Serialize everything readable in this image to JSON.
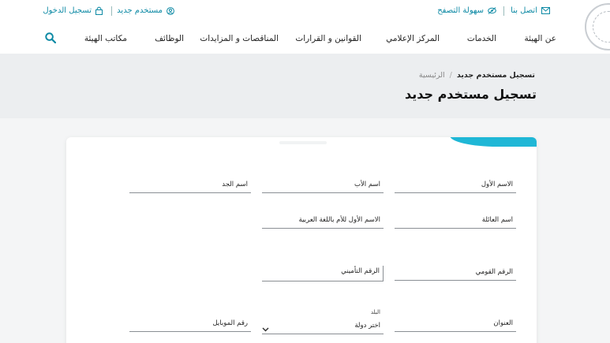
{
  "topbar": {
    "contact": "اتصل بنا",
    "accessibility": "سهولة التصفح",
    "new_user": "مستخدم جديد",
    "login": "تسجيل الدخول"
  },
  "nav": {
    "items": [
      "عن الهيئة",
      "الخدمات",
      "المركز الإعلامي",
      "القوانين و القرارات",
      "المناقصات و المزايدات",
      "الوظائف",
      "مكاتب الهيئة"
    ]
  },
  "breadcrumb": {
    "home": "الرئيسية",
    "separator": "/",
    "current": "تسجيل مستخدم جديد"
  },
  "page_title": "تسجيل مستخدم جديد",
  "form": {
    "first_name": "الاسم الأول",
    "father_name": "اسم الأب",
    "grandfather_name": "اسم الجد",
    "family_name": "اسم العائلة",
    "mother_first_name": "الاسم الأول للأم باللغة العربية",
    "national_id": "الرقم القومي",
    "insurance_number": "الرقم التأميني",
    "address": "العنوان",
    "country_label": "البلد",
    "country_value": "اختر دولة",
    "mobile": "رقم الموبايل"
  },
  "colors": {
    "accent": "#1fb7d6",
    "link": "#0e8aa5"
  }
}
